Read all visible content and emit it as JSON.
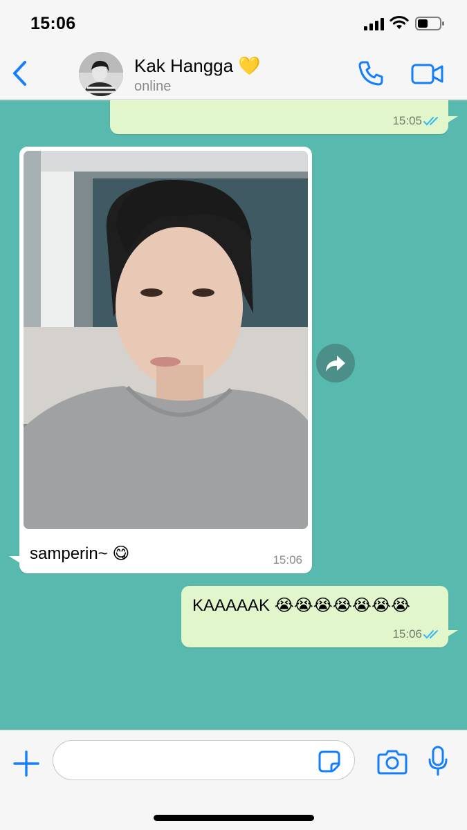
{
  "status_bar": {
    "time": "15:06",
    "icons": [
      "signal-icon",
      "wifi-icon",
      "battery-icon"
    ]
  },
  "header": {
    "back_icon": "chevron-left-icon",
    "contact_name": "Kak Hangga 💛",
    "contact_status": "online",
    "actions": [
      "phone-icon",
      "video-camera-icon"
    ]
  },
  "messages": [
    {
      "direction": "outgoing",
      "text": "",
      "time": "15:05",
      "read": true
    },
    {
      "direction": "incoming",
      "type": "photo",
      "caption": "samperin~ 😋",
      "time": "15:06"
    },
    {
      "direction": "outgoing",
      "text": "KAAAAAK 😭😭😭😭😭😭😭",
      "time": "15:06",
      "read": true
    }
  ],
  "input_bar": {
    "placeholder": "",
    "icons": [
      "plus-icon",
      "sticker-icon",
      "camera-icon",
      "microphone-icon"
    ]
  },
  "colors": {
    "accent": "#157efb",
    "chat_background": "#58b9af",
    "outgoing_bubble": "#e1f7cb",
    "incoming_bubble": "#ffffff",
    "read_ticks": "#34b7f1"
  }
}
